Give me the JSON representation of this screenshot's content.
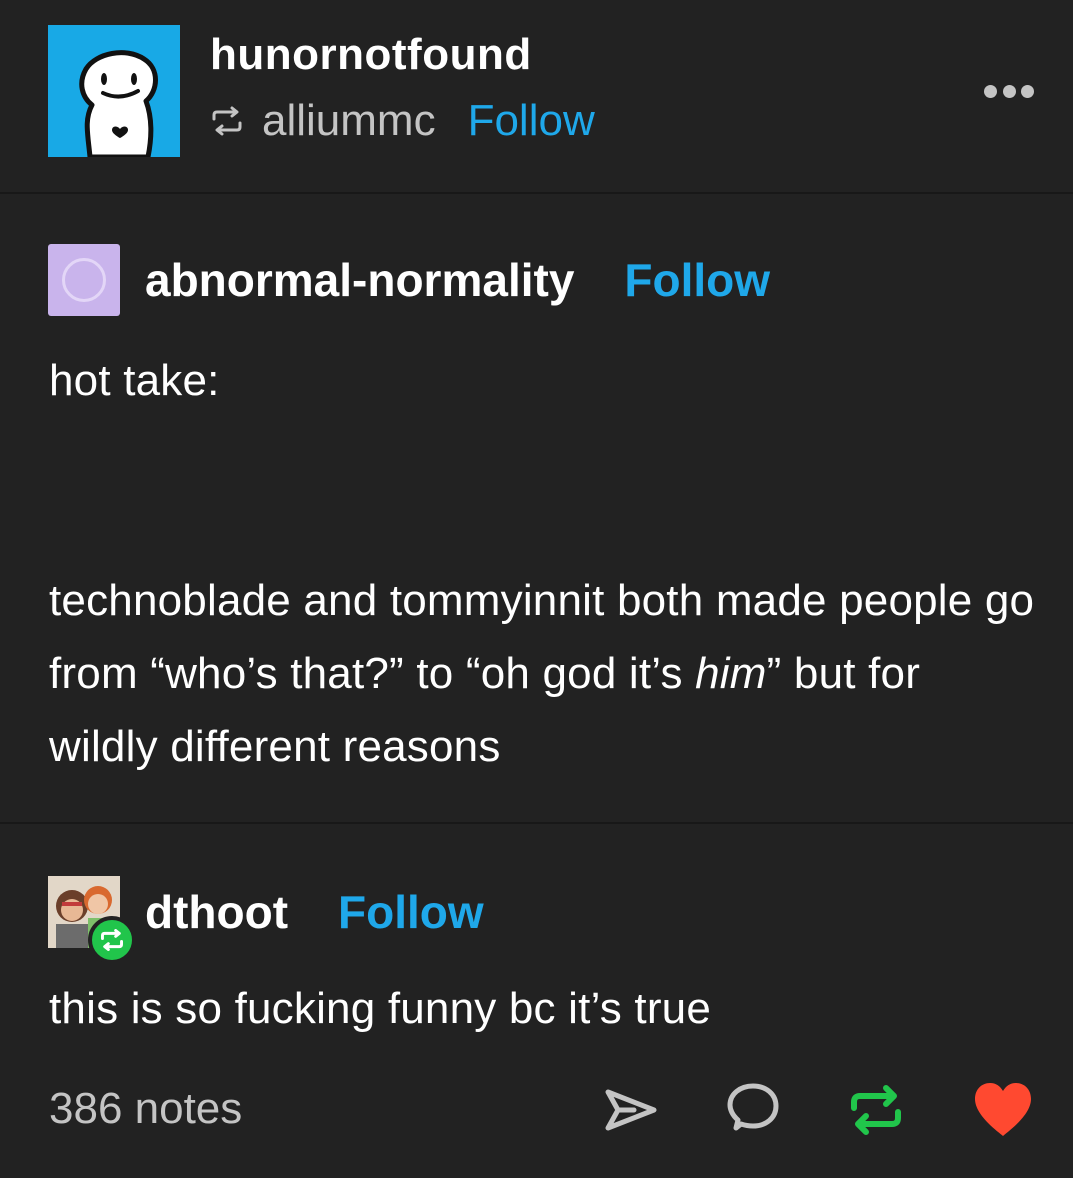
{
  "header": {
    "username": "hunornotfound",
    "reblogged_from": "alliummc",
    "follow_label": "Follow",
    "more_icon": "ellipsis-icon"
  },
  "original_post": {
    "author": "abnormal-normality",
    "follow_label": "Follow",
    "lines": [
      "hot take:",
      "technoblade and tommyinnit both made people go from “who’s that?” to “oh god it’s",
      "him",
      "” but for wildly different reasons"
    ]
  },
  "reply": {
    "author": "dthoot",
    "follow_label": "Follow",
    "text": "this is so fucking funny bc it’s true"
  },
  "footer": {
    "notes_label": "386 notes",
    "share_icon": "send-icon",
    "comment_icon": "comment-icon",
    "reblog_icon": "reblog-icon",
    "like_icon": "heart-icon"
  },
  "colors": {
    "background": "#222222",
    "accent": "#1fa8ea",
    "reblog_green": "#21c54b",
    "like_red": "#ff4930",
    "muted_text": "#c4c4c4"
  }
}
